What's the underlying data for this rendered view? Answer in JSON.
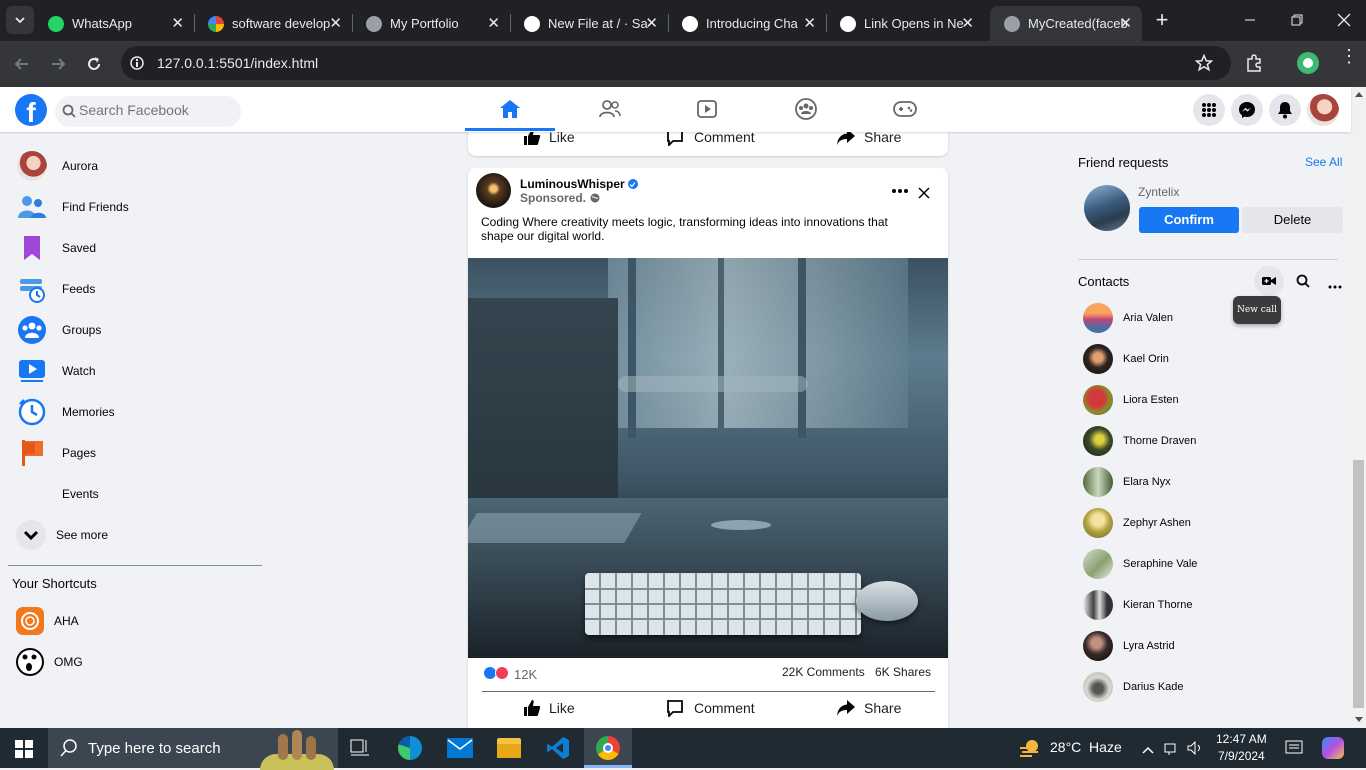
{
  "browser": {
    "tabs": [
      {
        "label": "WhatsApp",
        "icon": "whatsapp-icon",
        "color": "#25d366"
      },
      {
        "label": "software develop",
        "icon": "google-icon",
        "color": "#ffffff"
      },
      {
        "label": "My Portfolio",
        "icon": "globe-icon",
        "color": "#9aa0a6"
      },
      {
        "label": "New File at / · Sa",
        "icon": "github-icon",
        "color": "#ffffff"
      },
      {
        "label": "Introducing Cha",
        "icon": "openai-icon",
        "color": "#ffffff"
      },
      {
        "label": "Link Opens in Ne",
        "icon": "openai-icon",
        "color": "#ffffff"
      },
      {
        "label": "MyCreated(faceb",
        "icon": "globe-icon",
        "color": "#9aa0a6"
      }
    ],
    "url": "127.0.0.1:5501/index.html"
  },
  "header": {
    "search_placeholder": "Search Facebook",
    "brand_color": "#1877f2"
  },
  "sidebar": {
    "items": [
      {
        "label": "Aurora",
        "icon": "profile-avatar"
      },
      {
        "label": "Find Friends",
        "icon": "friends-icon"
      },
      {
        "label": "Saved",
        "icon": "bookmark-icon"
      },
      {
        "label": "Feeds",
        "icon": "feeds-icon"
      },
      {
        "label": "Groups",
        "icon": "groups-icon"
      },
      {
        "label": "Watch",
        "icon": "watch-icon"
      },
      {
        "label": "Memories",
        "icon": "clock-icon"
      },
      {
        "label": "Pages",
        "icon": "flag-icon"
      },
      {
        "label": "Events",
        "icon": ""
      },
      {
        "label": "See more",
        "icon": "chevron-down-icon"
      }
    ],
    "shortcuts_title": "Your Shortcuts",
    "shortcuts": [
      {
        "label": "AHA",
        "icon": "aha-icon"
      },
      {
        "label": "OMG",
        "icon": "omg-icon"
      }
    ]
  },
  "prev_post": {
    "like": "Like",
    "comment": "Comment",
    "share": "Share"
  },
  "post": {
    "author": "LuminousWhisper",
    "sponsored": "Sponsored.",
    "text": "Coding Where creativity meets logic, transforming ideas into innovations that shape our digital world.",
    "reactions": "12K",
    "comments": "22K Comments",
    "shares": "6K Shares",
    "like": "Like",
    "comment": "Comment",
    "share": "Share"
  },
  "right": {
    "friend_requests_title": "Friend requests",
    "see_all": "See All",
    "request_name": "Zyntelix",
    "confirm": "Confirm",
    "delete": "Delete",
    "contacts_title": "Contacts",
    "new_call_tooltip": "New call",
    "contacts": [
      "Aria Valen",
      "Kael Orin",
      "Liora Esten",
      "Thorne Draven",
      "Elara Nyx",
      "Zephyr Ashen",
      "Seraphine Vale",
      "Kieran Thorne",
      "Lyra Astrid",
      "Darius Kade"
    ]
  },
  "taskbar": {
    "search_placeholder": "Type here to search",
    "weather": "28°C  Haze",
    "time": "12:47 AM",
    "date": "7/9/2024"
  }
}
